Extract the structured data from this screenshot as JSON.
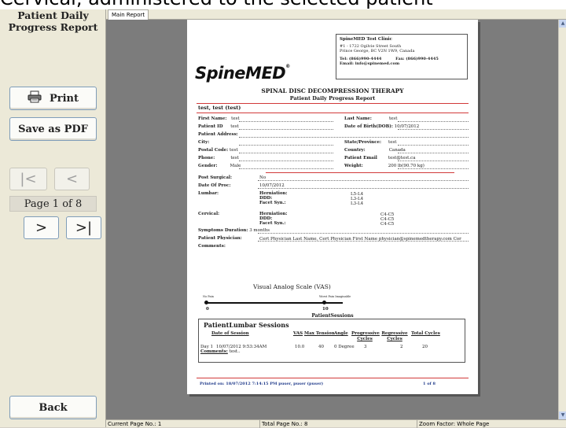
{
  "banner": {
    "text": "Cervical, administered to the selected patient"
  },
  "sidebar": {
    "title": "Patient Daily Progress Report",
    "print_label": "Print",
    "save_pdf_label": "Save as PDF",
    "first_label": "|<",
    "prev_label": "<",
    "page_indicator": "Page 1 of 8",
    "next_label": ">",
    "last_label": ">|",
    "back_label": "Back"
  },
  "tabs": [
    {
      "label": "Main Report"
    }
  ],
  "status": {
    "current_page": "Current Page No.: 1",
    "total_page": "Total Page No.: 8",
    "zoom": "Zoom Factor: Whole Page"
  },
  "report": {
    "clinic": {
      "name": "SpineMED Test Clinic",
      "address1": "#1 - 1722 Ogilvie Street South",
      "address2": "Prince George, BC V2N 1W9, Canada",
      "tel": "Tel: (866)990-4444",
      "fax": "Fax: (866)990-4445",
      "email": "Email: info@spinemed.com"
    },
    "logo": "SpineMED",
    "heading": "SPINAL DISC DECOMPRESSION THERAPY",
    "subheading": "Patient Daily Progress Report",
    "patient_name": "test, test (test)",
    "fields": {
      "first_name_label": "First Name:",
      "first_name": "test",
      "last_name_label": "Last Name:",
      "last_name": "test",
      "patient_id_label": "Patient ID",
      "patient_id": "test",
      "dob_label": "Date of Birth(DOB):",
      "dob": "10/07/2012",
      "address_label": "Patient Address:",
      "city_label": "City:",
      "state_label": "State/Province:",
      "state": "test",
      "postal_label": "Postal Code:",
      "postal": "test",
      "country_label": "Country:",
      "country": "Canada",
      "phone_label": "Phone:",
      "phone": "test",
      "email_label": "Patient Email",
      "email": "test@test.ca",
      "gender_label": "Gender:",
      "gender": "Male",
      "weight_label": "Weight:",
      "weight": "200 lb(90.70 kg)"
    },
    "clinical": {
      "post_surgical_label": "Post Surgical:",
      "post_surgical": "No",
      "date_proc_label": "Date Of Proc:",
      "date_proc": "10/07/2012",
      "lumbar_label": "Lumbar:",
      "herniation_label": "Herniation:",
      "ddd_label": "DDD:",
      "facet_label": "Facet Syn.:",
      "lumbar_herniation": "L5-L4",
      "lumbar_ddd": "L3-L4",
      "lumbar_facet": "L3-L4",
      "cervical_label": "Cervical:",
      "cervical_herniation": "C4-C5",
      "cervical_ddd": "C4-C5",
      "cervical_facet": "C4-C5",
      "symptoms_label": "Symptoms Duration:",
      "symptoms": "3 months",
      "physician_label": "Patient Physician:",
      "physician": "Cert Physician Last Name, Cert Physician First Name physician@spinemedtherapy.com Cor",
      "comments_label": "Comments:"
    },
    "vas": {
      "title": "Visual Analog Scale (VAS)",
      "left_label": "No Pain",
      "right_label": "Worst Pain Imaginable",
      "min": "0",
      "max": "10"
    },
    "sessions_heading": "PatientSessions",
    "lumbar_sessions": {
      "title": "PatientLumbar Sessions",
      "headers": [
        "Date of Session",
        "VAS",
        "Max Tension",
        "Angle",
        "Progressive Cycles",
        "Regressive Cycles",
        "Total Cycles"
      ],
      "rows": [
        {
          "day": "Day 1",
          "date": "10/07/2012 9:53:34AM",
          "vas": "10.0",
          "tension": "40",
          "angle": "0 Degree",
          "prog": "3",
          "reg": "2",
          "total": "20"
        }
      ],
      "comments_label": "Comments:",
      "comments": "test.."
    },
    "footer_printed": "Printed on: 18/07/2012 7:14:15 PM puser, puser (puser)",
    "footer_page": "1 of 8"
  }
}
